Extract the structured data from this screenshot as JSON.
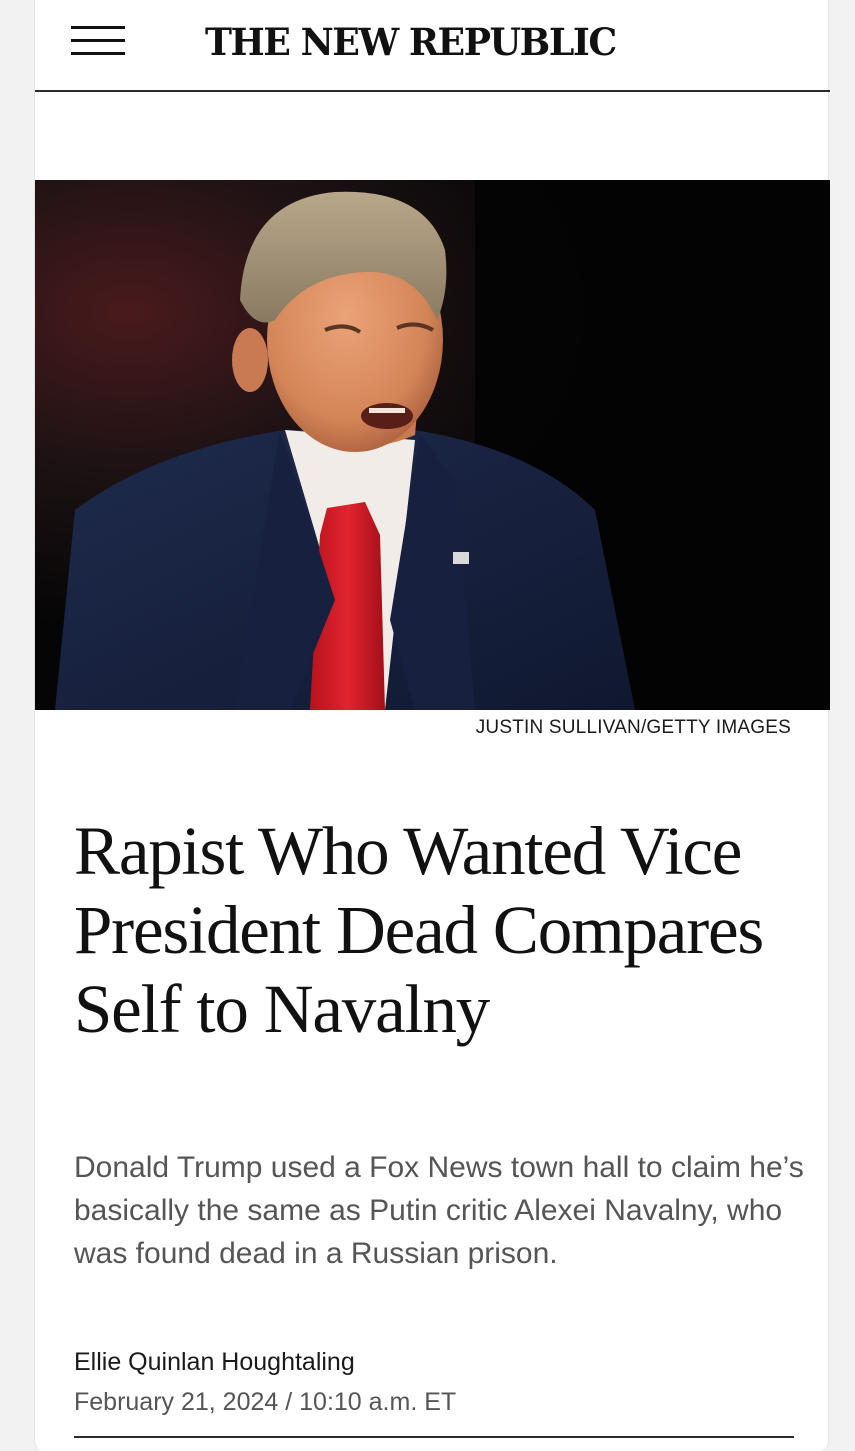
{
  "header": {
    "logo": "THE NEW REPUBLIC",
    "menu_icon": "hamburger-menu-icon"
  },
  "hero": {
    "credit": "JUSTIN SULLIVAN/GETTY IMAGES"
  },
  "article": {
    "headline": "Rapist Who Wanted Vice President Dead Compares Self to Navalny",
    "dek": "Donald Trump used a Fox News town hall to claim he’s basically the same as Putin critic Alexei Navalny, who was found dead in a Russian prison.",
    "author": "Ellie Quinlan Houghtaling",
    "date": "February 21, 2024 / 10:10 a.m. ET"
  }
}
